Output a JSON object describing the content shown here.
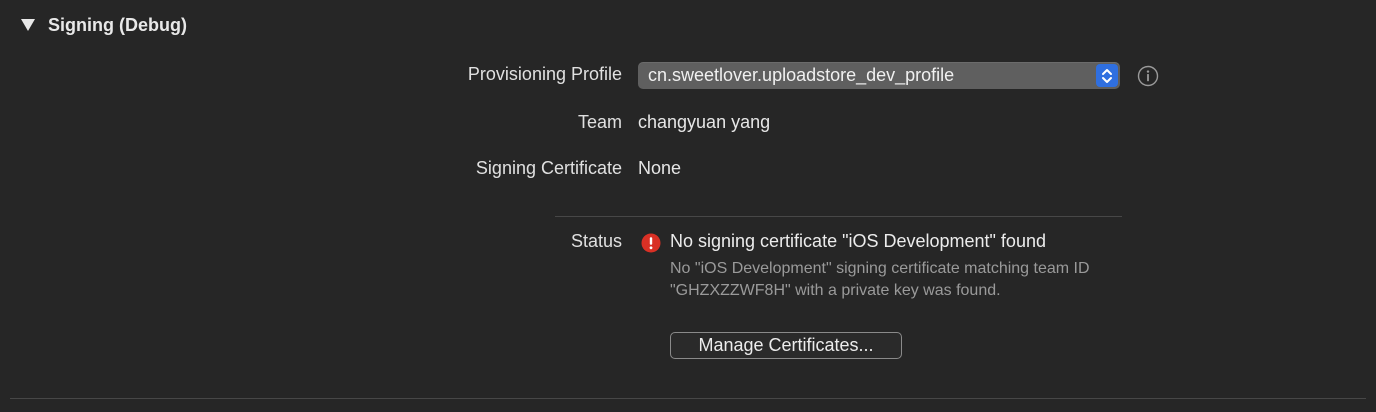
{
  "section": {
    "title": "Signing (Debug)",
    "disclosure_icon": "disclosure-triangle-down-icon"
  },
  "provisioning": {
    "label": "Provisioning Profile",
    "value": "cn.sweetlover.uploadstore_dev_profile",
    "stepper_icon": "popup-stepper-icon",
    "info_icon": "info-icon"
  },
  "team": {
    "label": "Team",
    "value": "changyuan yang"
  },
  "certificate": {
    "label": "Signing Certificate",
    "value": "None"
  },
  "status": {
    "label": "Status",
    "icon": "error-icon",
    "title": "No signing certificate \"iOS Development\" found",
    "detail": "No \"iOS Development\" signing certificate matching team ID \"GHZXZZWF8H\" with a private key was found.",
    "button_label": "Manage Certificates..."
  },
  "colors": {
    "background": "#262626",
    "accent": "#2f6fe0",
    "error": "#d93025"
  }
}
